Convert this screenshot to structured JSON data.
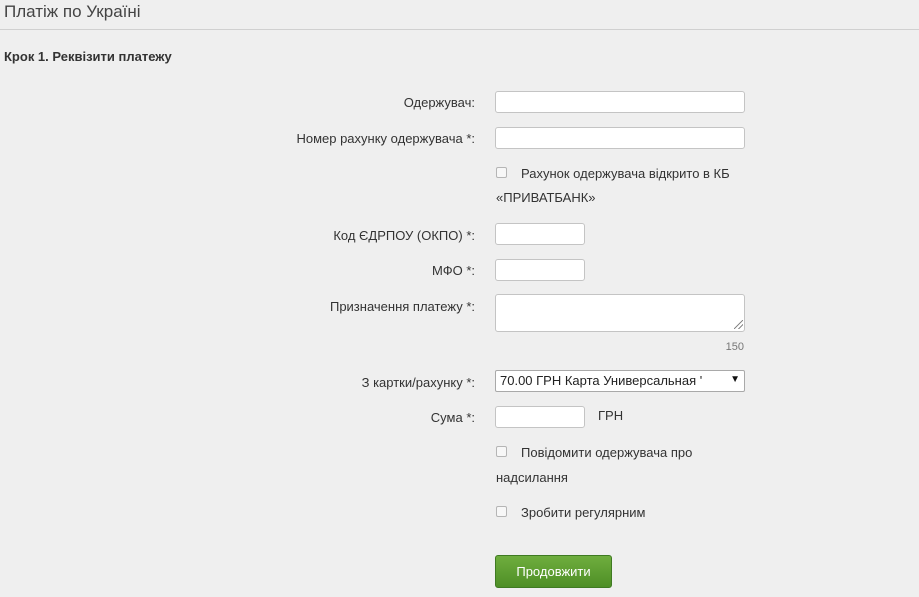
{
  "header": {
    "title": "Платіж по Україні",
    "edge_glyph": "("
  },
  "form": {
    "step_title": "Крок 1. Реквізити платежу",
    "recipient": {
      "label": "Одержувач:",
      "value": ""
    },
    "account": {
      "label": "Номер рахунку одержувача *:",
      "value": ""
    },
    "privatbank_check": {
      "text_line1": "Рахунок одержувача відкрито в КБ",
      "text_line2": "«ПРИВАТБАНК»",
      "checked": false
    },
    "edrpou": {
      "label": "Код ЄДРПОУ (ОКПО) *:",
      "value": ""
    },
    "mfo": {
      "label": "МФО *:",
      "value": ""
    },
    "purpose": {
      "label": "Призначення платежу *:",
      "value": "",
      "counter": "150"
    },
    "source_card": {
      "label": "З картки/рахунку *:",
      "selected": "70.00 ГРН  Карта Универсальная '",
      "arrow": "▼"
    },
    "amount": {
      "label": "Сума *:",
      "value": "",
      "currency": "ГРН"
    },
    "notify_check": {
      "text_line1": "Повідомити одержувача про",
      "text_line2": "надсилання",
      "checked": false
    },
    "regular_check": {
      "text": "Зробити регулярним",
      "checked": false
    },
    "submit_label": "Продовжити"
  }
}
